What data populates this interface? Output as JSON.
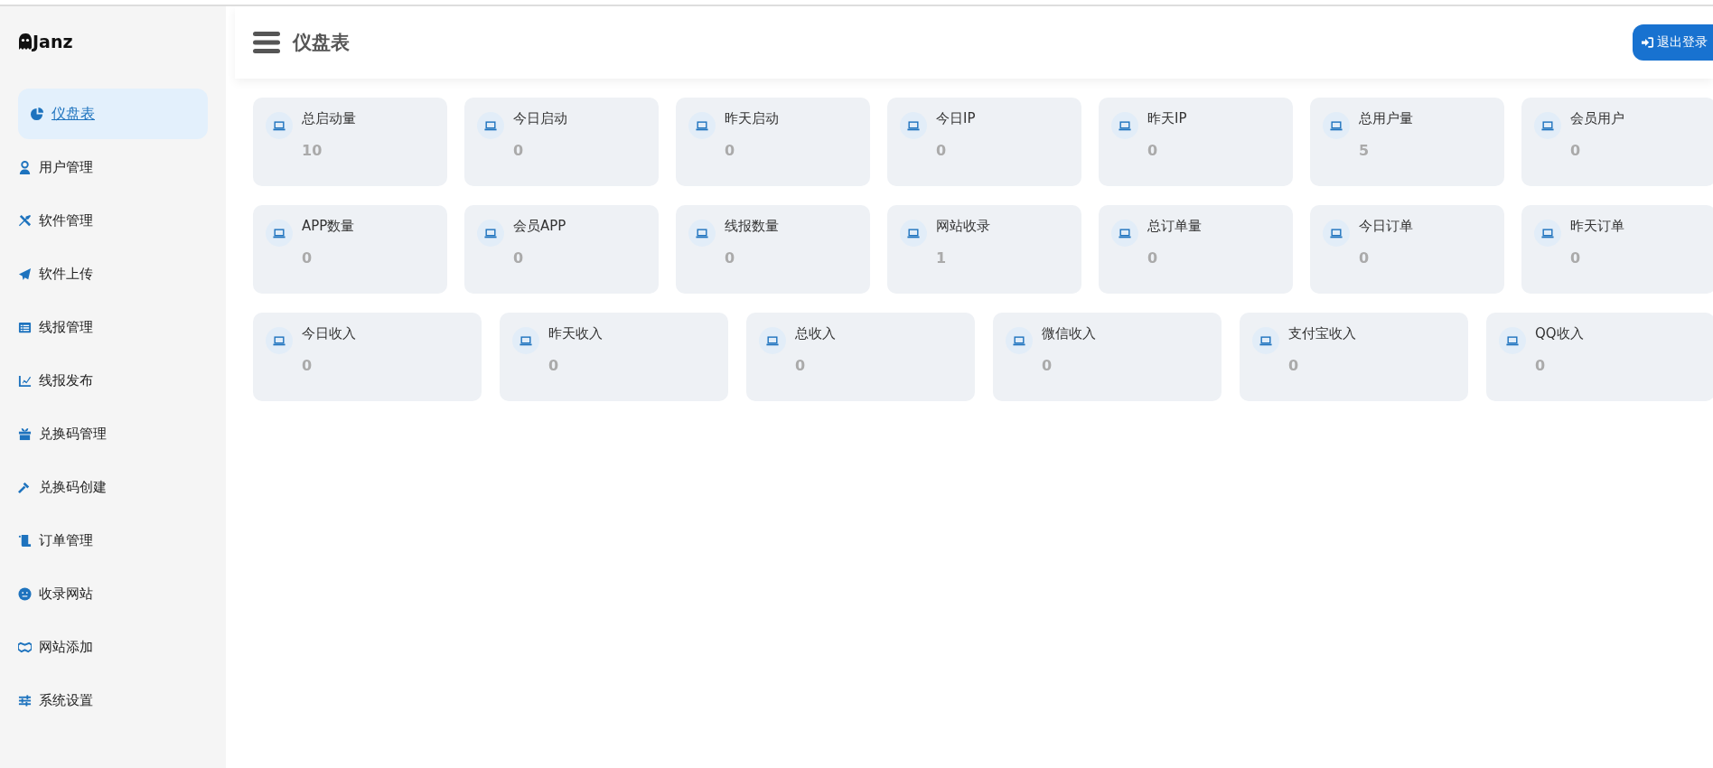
{
  "brand": {
    "name": "Janz"
  },
  "sidebar": {
    "items": [
      {
        "label": "仪盘表",
        "selected": true
      },
      {
        "label": "用户管理",
        "selected": false
      },
      {
        "label": "软件管理",
        "selected": false
      },
      {
        "label": "软件上传",
        "selected": false
      },
      {
        "label": "线报管理",
        "selected": false
      },
      {
        "label": "线报发布",
        "selected": false
      },
      {
        "label": "兑换码管理",
        "selected": false
      },
      {
        "label": "兑换码创建",
        "selected": false
      },
      {
        "label": "订单管理",
        "selected": false
      },
      {
        "label": "收录网站",
        "selected": false
      },
      {
        "label": "网站添加",
        "selected": false
      },
      {
        "label": "系统设置",
        "selected": false
      }
    ]
  },
  "header": {
    "title": "仪盘表",
    "logout": "退出登录"
  },
  "stat_rows": [
    [
      {
        "label": "总启动量",
        "value": "10"
      },
      {
        "label": "今日启动",
        "value": "0"
      },
      {
        "label": "昨天启动",
        "value": "0"
      },
      {
        "label": "今日IP",
        "value": "0"
      },
      {
        "label": "昨天IP",
        "value": "0"
      },
      {
        "label": "总用户量",
        "value": "5"
      },
      {
        "label": "会员用户",
        "value": "0"
      }
    ],
    [
      {
        "label": "APP数量",
        "value": "0"
      },
      {
        "label": "会员APP",
        "value": "0"
      },
      {
        "label": "线报数量",
        "value": "0"
      },
      {
        "label": "网站收录",
        "value": "1"
      },
      {
        "label": "总订单量",
        "value": "0"
      },
      {
        "label": "今日订单",
        "value": "0"
      },
      {
        "label": "昨天订单",
        "value": "0"
      }
    ],
    [
      {
        "label": "今日收入",
        "value": "0"
      },
      {
        "label": "昨天收入",
        "value": "0"
      },
      {
        "label": "总收入",
        "value": "0"
      },
      {
        "label": "微信收入",
        "value": "0"
      },
      {
        "label": "支付宝收入",
        "value": "0"
      },
      {
        "label": "QQ收入",
        "value": "0"
      }
    ]
  ]
}
